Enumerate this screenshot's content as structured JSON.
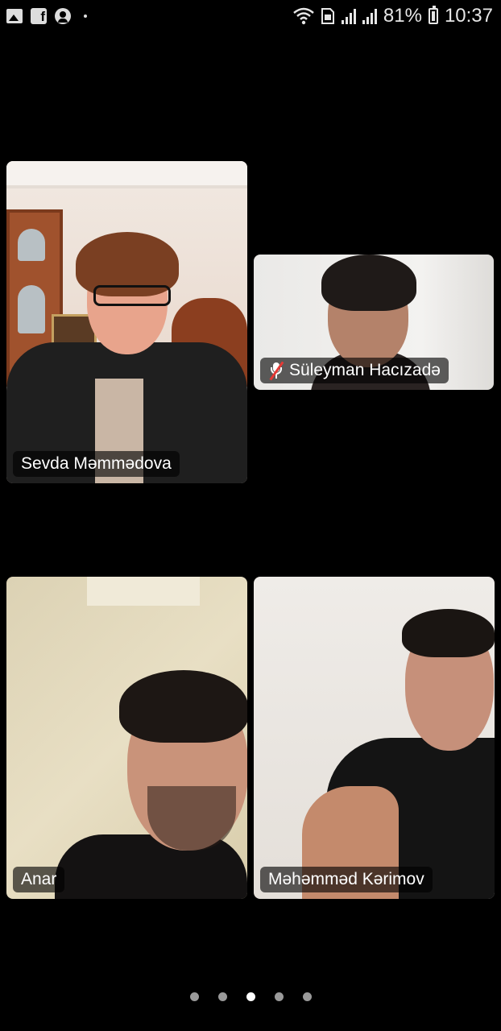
{
  "status_bar": {
    "battery_percent": "81%",
    "time": "10:37",
    "left_icons": [
      "gallery-icon",
      "facebook-icon",
      "user-icon",
      "dot-icon"
    ],
    "right_icons": [
      "wifi-icon",
      "sim-icon",
      "signal-icon",
      "signal-icon",
      "battery-icon"
    ]
  },
  "participants": [
    {
      "name": "Sevda Məmmədova",
      "muted": false
    },
    {
      "name": "Süleyman Hacızadə",
      "muted": true
    },
    {
      "name": "Anar",
      "muted": false
    },
    {
      "name": "Məhəmməd Kərimov",
      "muted": false
    }
  ],
  "pager": {
    "count": 5,
    "active": 3
  }
}
